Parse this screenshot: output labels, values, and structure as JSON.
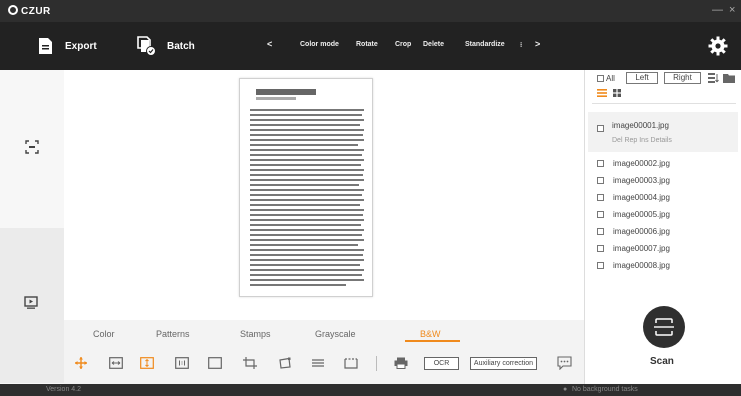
{
  "app": {
    "logo_text": "CZUR",
    "minimize_glyph": "—",
    "close_glyph": "×"
  },
  "toolbar": {
    "export_label": "Export",
    "batch_label": "Batch",
    "prev_glyph": "<",
    "next_glyph": ">",
    "more_glyph": "⁝",
    "tools": [
      "Color mode",
      "Rotate",
      "Crop",
      "Delete",
      "Standardize"
    ]
  },
  "files": {
    "all_label": "All",
    "left_label": "Left",
    "right_label": "Right",
    "selected": {
      "name": "image00001.jpg",
      "actions": "Del  Rep  Ins  Details"
    },
    "items": [
      "image00002.jpg",
      "image00003.jpg",
      "image00004.jpg",
      "image00005.jpg",
      "image00006.jpg",
      "image00007.jpg",
      "image00008.jpg"
    ]
  },
  "filters": {
    "color": "Color",
    "patterns": "Patterns",
    "stamps": "Stamps",
    "grayscale": "Grayscale",
    "bw": "B&W",
    "active": "B&W"
  },
  "bottom_tools": {
    "ocr_label": "OCR",
    "aux_label": "Auxiliary correction"
  },
  "scan": {
    "label": "Scan"
  },
  "status": {
    "version": "Version 4.2",
    "tasks": "No background tasks"
  },
  "colors": {
    "accent": "#f08a1c",
    "toolbar": "#222222",
    "titlebar": "#2e2e2e"
  }
}
